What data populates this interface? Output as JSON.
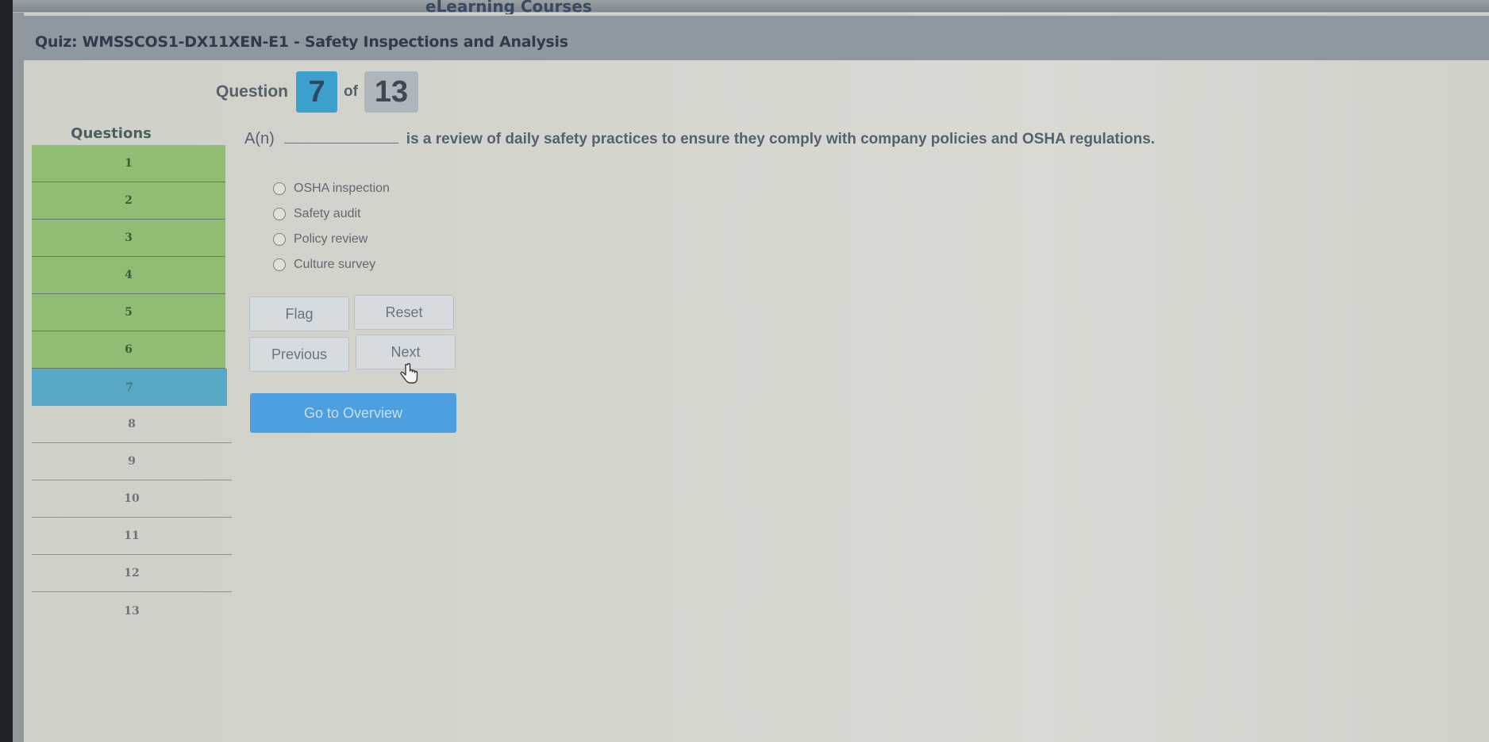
{
  "app": {
    "title": "eLearning Courses"
  },
  "quiz": {
    "title": "Quiz: WMSSCOS1-DX11XEN-E1 - Safety Inspections and Analysis"
  },
  "counter": {
    "label": "Question",
    "current": "7",
    "of_label": "of",
    "total": "13"
  },
  "sidebar": {
    "title": "Questions",
    "items": [
      {
        "label": "1",
        "status": "answered"
      },
      {
        "label": "2",
        "status": "answered"
      },
      {
        "label": "3",
        "status": "answered"
      },
      {
        "label": "4",
        "status": "answered"
      },
      {
        "label": "5",
        "status": "answered"
      },
      {
        "label": "6",
        "status": "answered"
      },
      {
        "label": "7",
        "status": "current"
      },
      {
        "label": "8",
        "status": "unanswered"
      },
      {
        "label": "9",
        "status": "unanswered"
      },
      {
        "label": "10",
        "status": "unanswered"
      },
      {
        "label": "11",
        "status": "unanswered"
      },
      {
        "label": "12",
        "status": "unanswered"
      },
      {
        "label": "13",
        "status": "unanswered"
      }
    ]
  },
  "question": {
    "prefix": "A(n)",
    "text": "is a review of daily safety practices to ensure they comply with company policies and OSHA regulations.",
    "options": [
      {
        "label": "OSHA inspection",
        "selected": false
      },
      {
        "label": "Safety audit",
        "selected": false
      },
      {
        "label": "Policy review",
        "selected": false
      },
      {
        "label": "Culture survey",
        "selected": false
      }
    ]
  },
  "buttons": {
    "flag": "Flag",
    "reset": "Reset",
    "previous": "Previous",
    "next": "Next",
    "overview": "Go to Overview"
  },
  "colors": {
    "answered": "#8fbd73",
    "current": "#56a8c4",
    "primary_button": "#4d9fdf",
    "counter_current": "#3d9fcc",
    "counter_total": "#aeb5bd"
  }
}
